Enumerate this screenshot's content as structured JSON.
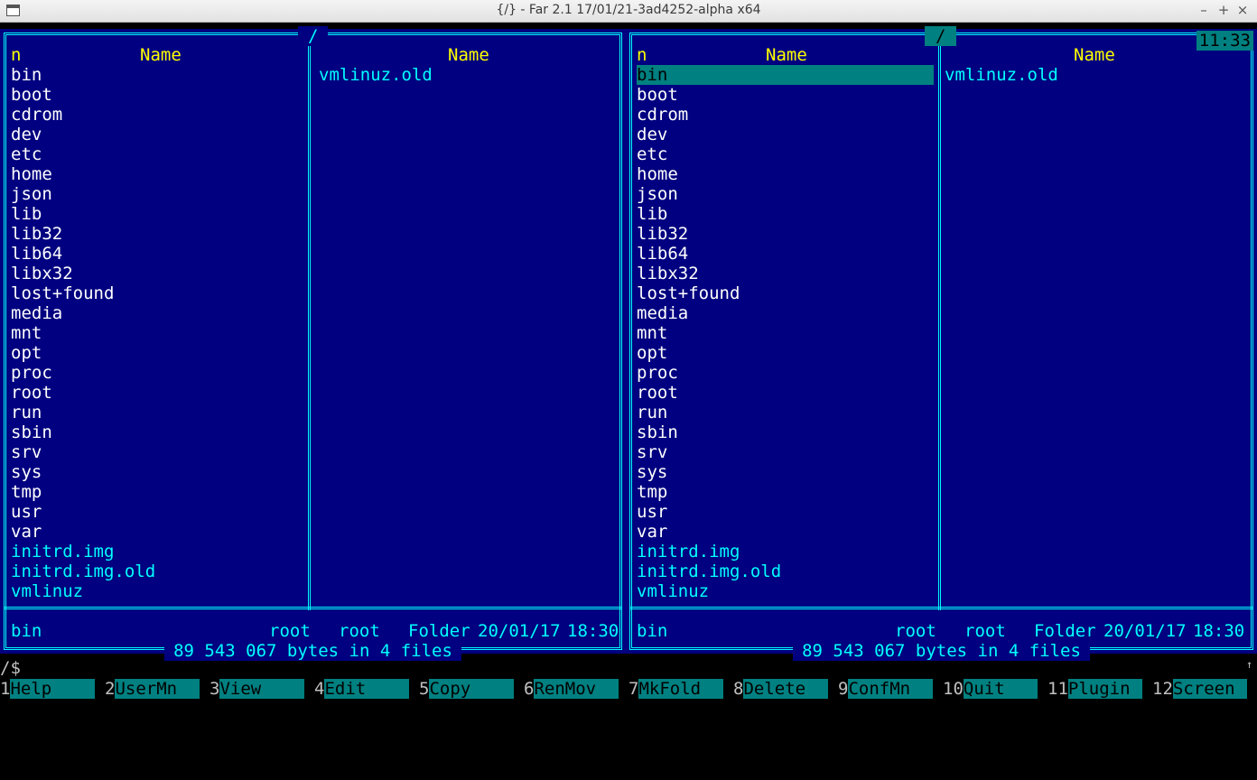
{
  "window": {
    "title": "{/} - Far 2.1 17/01/21-3ad4252-alpha x64",
    "controls": [
      "–",
      "+",
      "×"
    ]
  },
  "clock": "11:33",
  "colors": {
    "panel_bg": "#000080",
    "frame": "#00ffff",
    "header": "#ffff00",
    "cursor": "#008080"
  },
  "left_panel": {
    "path": "/",
    "col1_n": "n",
    "col1_name": "Name",
    "col2_name": "Name",
    "col1_items": [
      {
        "name": "bin",
        "type": "dir"
      },
      {
        "name": "boot",
        "type": "dir"
      },
      {
        "name": "cdrom",
        "type": "dir"
      },
      {
        "name": "dev",
        "type": "dir"
      },
      {
        "name": "etc",
        "type": "dir"
      },
      {
        "name": "home",
        "type": "dir"
      },
      {
        "name": "json",
        "type": "dir"
      },
      {
        "name": "lib",
        "type": "dir"
      },
      {
        "name": "lib32",
        "type": "dir"
      },
      {
        "name": "lib64",
        "type": "dir"
      },
      {
        "name": "libx32",
        "type": "dir"
      },
      {
        "name": "lost+found",
        "type": "dir"
      },
      {
        "name": "media",
        "type": "dir"
      },
      {
        "name": "mnt",
        "type": "dir"
      },
      {
        "name": "opt",
        "type": "dir"
      },
      {
        "name": "proc",
        "type": "dir"
      },
      {
        "name": "root",
        "type": "dir"
      },
      {
        "name": "run",
        "type": "dir"
      },
      {
        "name": "sbin",
        "type": "dir"
      },
      {
        "name": "srv",
        "type": "dir"
      },
      {
        "name": "sys",
        "type": "dir"
      },
      {
        "name": "tmp",
        "type": "dir"
      },
      {
        "name": "usr",
        "type": "dir"
      },
      {
        "name": "var",
        "type": "dir"
      },
      {
        "name": "initrd.img",
        "type": "file"
      },
      {
        "name": "initrd.img.old",
        "type": "file"
      },
      {
        "name": "vmlinuz",
        "type": "file"
      }
    ],
    "col2_items": [
      {
        "name": "vmlinuz.old",
        "type": "file"
      }
    ],
    "status": {
      "name": "bin",
      "owner": "root",
      "group": "root",
      "kind": "Folder",
      "date": "20/01/17",
      "time": "18:30"
    },
    "summary": "89 543 067 bytes in 4 files"
  },
  "right_panel": {
    "path": "/",
    "col1_n": "n",
    "col1_name": "Name",
    "col2_name": "Name",
    "selected_index": 0,
    "col1_items": [
      {
        "name": "bin",
        "type": "dir"
      },
      {
        "name": "boot",
        "type": "dir"
      },
      {
        "name": "cdrom",
        "type": "dir"
      },
      {
        "name": "dev",
        "type": "dir"
      },
      {
        "name": "etc",
        "type": "dir"
      },
      {
        "name": "home",
        "type": "dir"
      },
      {
        "name": "json",
        "type": "dir"
      },
      {
        "name": "lib",
        "type": "dir"
      },
      {
        "name": "lib32",
        "type": "dir"
      },
      {
        "name": "lib64",
        "type": "dir"
      },
      {
        "name": "libx32",
        "type": "dir"
      },
      {
        "name": "lost+found",
        "type": "dir"
      },
      {
        "name": "media",
        "type": "dir"
      },
      {
        "name": "mnt",
        "type": "dir"
      },
      {
        "name": "opt",
        "type": "dir"
      },
      {
        "name": "proc",
        "type": "dir"
      },
      {
        "name": "root",
        "type": "dir"
      },
      {
        "name": "run",
        "type": "dir"
      },
      {
        "name": "sbin",
        "type": "dir"
      },
      {
        "name": "srv",
        "type": "dir"
      },
      {
        "name": "sys",
        "type": "dir"
      },
      {
        "name": "tmp",
        "type": "dir"
      },
      {
        "name": "usr",
        "type": "dir"
      },
      {
        "name": "var",
        "type": "dir"
      },
      {
        "name": "initrd.img",
        "type": "file"
      },
      {
        "name": "initrd.img.old",
        "type": "file"
      },
      {
        "name": "vmlinuz",
        "type": "file"
      }
    ],
    "col2_items": [
      {
        "name": "vmlinuz.old",
        "type": "file"
      }
    ],
    "status": {
      "name": "bin",
      "owner": "root",
      "group": "root",
      "kind": "Folder",
      "date": "20/01/17",
      "time": "18:30"
    },
    "summary": "89 543 067 bytes in 4 files"
  },
  "command_line": {
    "prompt": "/$",
    "scroll_indicator": "↑"
  },
  "keybar": [
    {
      "num": "1",
      "label": "Help"
    },
    {
      "num": "2",
      "label": "UserMn"
    },
    {
      "num": "3",
      "label": "View"
    },
    {
      "num": "4",
      "label": "Edit"
    },
    {
      "num": "5",
      "label": "Copy"
    },
    {
      "num": "6",
      "label": "RenMov"
    },
    {
      "num": "7",
      "label": "MkFold"
    },
    {
      "num": "8",
      "label": "Delete"
    },
    {
      "num": "9",
      "label": "ConfMn"
    },
    {
      "num": "10",
      "label": "Quit"
    },
    {
      "num": "11",
      "label": "Plugin"
    },
    {
      "num": "12",
      "label": "Screen"
    }
  ]
}
